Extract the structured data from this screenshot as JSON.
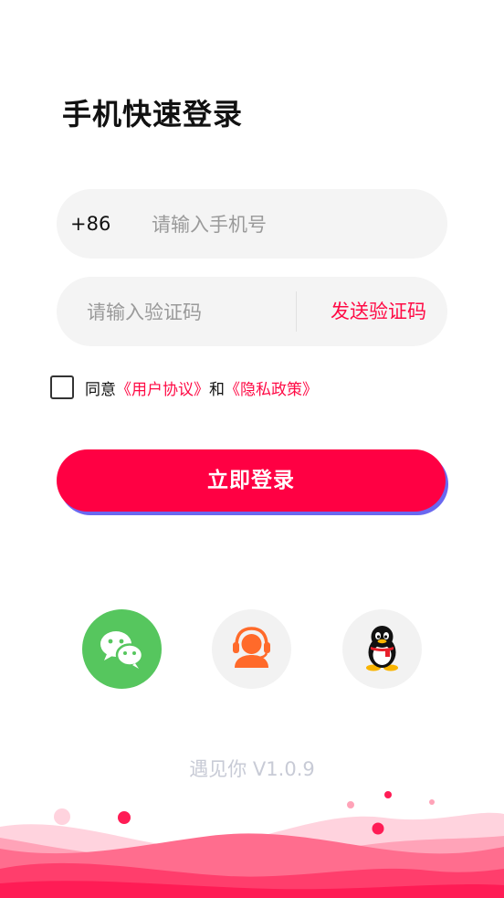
{
  "page": {
    "title": "手机快速登录"
  },
  "phone": {
    "prefix": "+86",
    "placeholder": "请输入手机号"
  },
  "code": {
    "placeholder": "请输入验证码",
    "send_label": "发送验证码"
  },
  "agreement": {
    "prefix": "同意",
    "user_agreement": "《用户协议》",
    "joiner": "和",
    "privacy_policy": "《隐私政策》"
  },
  "login_button": "立即登录",
  "social": [
    "wechat-icon",
    "customer-service-icon",
    "qq-icon"
  ],
  "version": "遇见你 V1.0.9",
  "colors": {
    "accent": "#ff0043",
    "button_shadow": "#6a68f0",
    "wechat": "#56c65e",
    "link": "#ff0a45"
  }
}
